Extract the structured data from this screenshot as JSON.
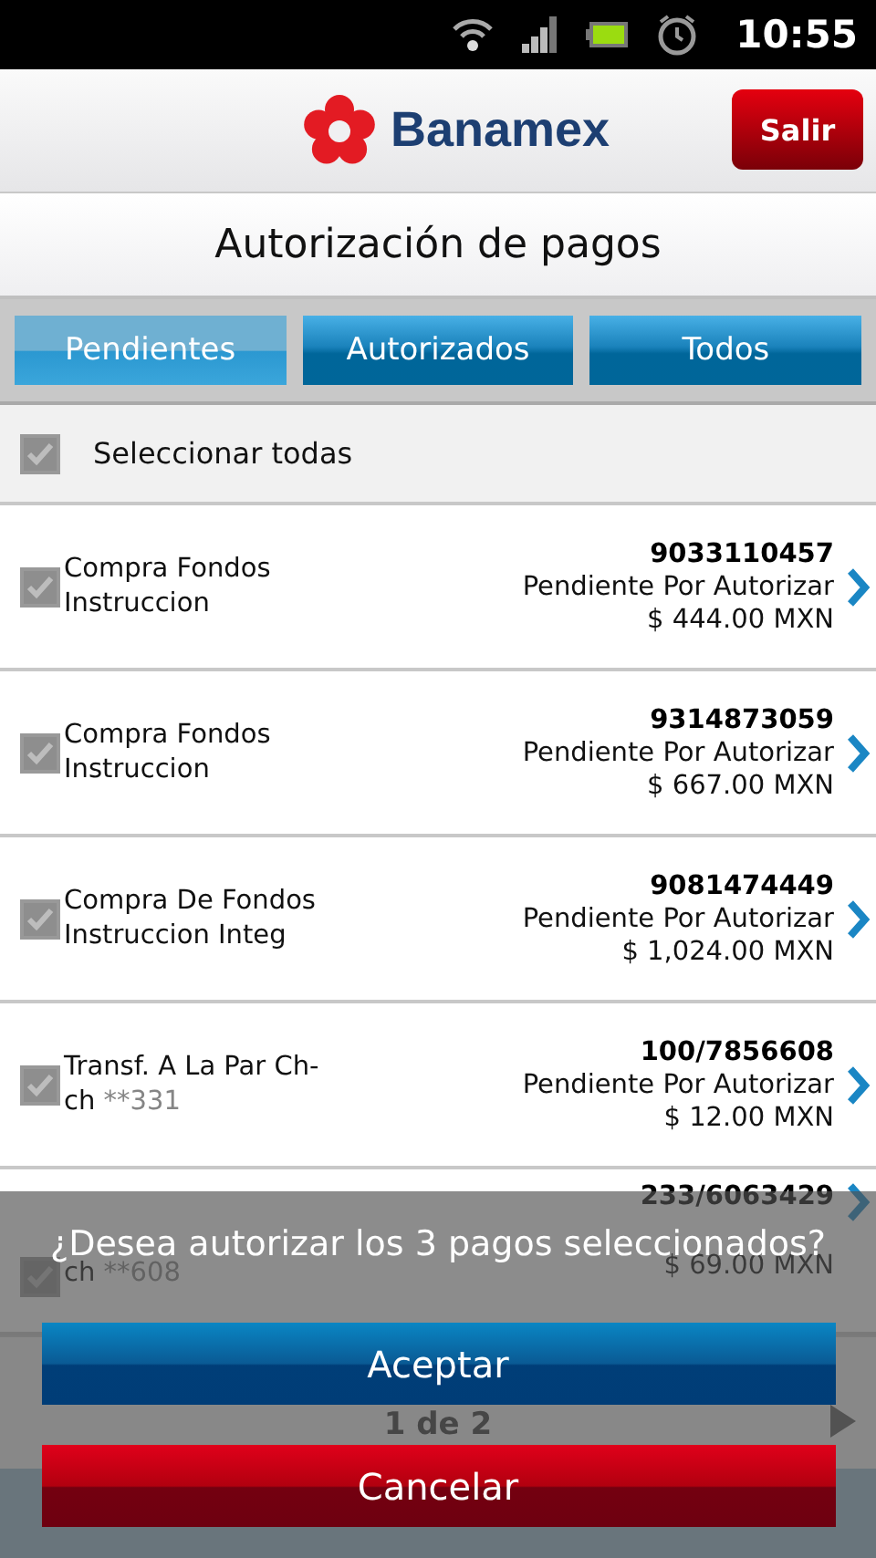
{
  "status_bar": {
    "time": "10:55"
  },
  "header": {
    "brand": "Banamex",
    "logout_button": "Salir"
  },
  "title": "Autorización de pagos",
  "tabs": [
    {
      "label": "Pendientes",
      "selected": true
    },
    {
      "label": "Autorizados",
      "selected": false
    },
    {
      "label": "Todos",
      "selected": false
    }
  ],
  "select_all": {
    "label": "Seleccionar todas",
    "checked": true
  },
  "payments": [
    {
      "name": "Compra Fondos Instruccion",
      "number": "9033110457",
      "status": "Pendiente Por Autorizar",
      "amount": "$ 444.00 MXN",
      "checked": true
    },
    {
      "name": "Compra Fondos Instruccion",
      "number": "9314873059",
      "status": "Pendiente Por Autorizar",
      "amount": "$ 667.00 MXN",
      "checked": true
    },
    {
      "name": "Compra De Fondos Instruccion Integ",
      "number": "9081474449",
      "status": "Pendiente Por Autorizar",
      "amount": "$ 1,024.00 MXN",
      "checked": true
    },
    {
      "name": "Transf. A La Par Ch-ch",
      "ref": "**331",
      "number": "100/7856608",
      "status": "Pendiente Por Autorizar",
      "amount": "$ 12.00 MXN",
      "checked": true
    },
    {
      "name": "ch",
      "ref": "**608",
      "number": "233/6063429",
      "amount": "$ 69.00 MXN",
      "checked": true
    }
  ],
  "pagination": {
    "label": "1 de 2"
  },
  "dialog": {
    "message": "¿Desea autorizar los 3 pagos seleccionados?",
    "buttons": [
      {
        "label": "Aceptar",
        "kind": "confirm"
      },
      {
        "label": "Cancelar",
        "kind": "cancel"
      }
    ]
  }
}
